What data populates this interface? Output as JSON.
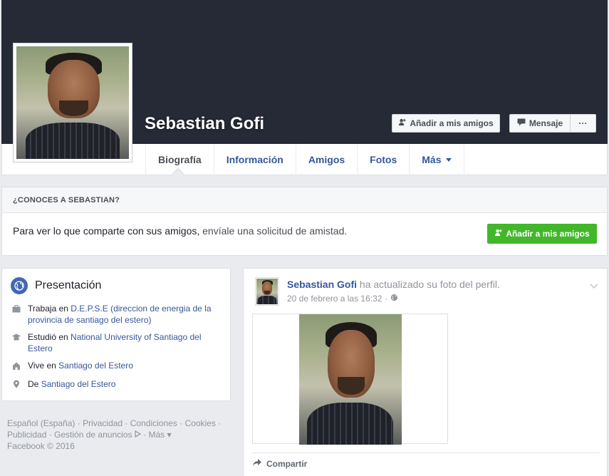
{
  "profile": {
    "name": "Sebastian Gofi"
  },
  "actions": {
    "add_friend": "Añadir a mis amigos",
    "message": "Mensaje",
    "more": "···"
  },
  "tabs": [
    {
      "label": "Biografía",
      "active": true
    },
    {
      "label": "Información"
    },
    {
      "label": "Amigos"
    },
    {
      "label": "Fotos"
    },
    {
      "label": "Más"
    }
  ],
  "know": {
    "heading": "¿CONOCES A SEBASTIAN?",
    "text": "Para ver lo que comparte con sus amigos, ",
    "text_link": "envíale una solicitud de amistad.",
    "button": "Añadir a mis amigos"
  },
  "intro": {
    "title": "Presentación",
    "items": [
      {
        "icon": "briefcase-icon",
        "prefix": "Trabaja en ",
        "link": "D.E.P.S.E (direccion de energia de la provincia de santiago del estero)"
      },
      {
        "icon": "school-icon",
        "prefix": "Estudió en ",
        "link": "National University of Santiago del Estero"
      },
      {
        "icon": "home-icon",
        "prefix": "Vive en ",
        "link": "Santiago del Estero"
      },
      {
        "icon": "location-pin-icon",
        "prefix": "De ",
        "link": "Santiago del Estero"
      }
    ]
  },
  "footer": {
    "links": [
      "Español (España)",
      "Privacidad",
      "Condiciones",
      "Cookies",
      "Publicidad",
      "Gestión de anuncios",
      "Más"
    ],
    "copyright": "Facebook © 2016"
  },
  "post": {
    "author": "Sebastian Gofi",
    "action": "ha actualizado su foto del perfil.",
    "timestamp": "20 de febrero a las 16:32",
    "share": "Compartir"
  },
  "colors": {
    "cover": "#262a37",
    "link": "#365899",
    "green": "#42b72a",
    "background": "#e9ebee"
  }
}
